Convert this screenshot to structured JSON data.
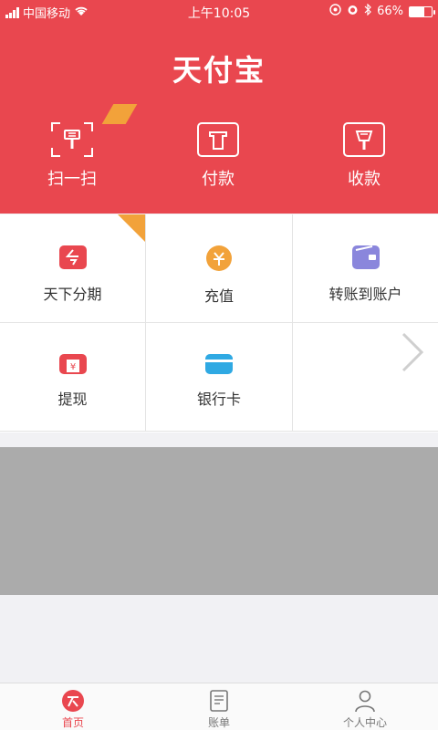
{
  "status_bar": {
    "carrier": "中国移动",
    "time": "上午10:05",
    "battery": "66%",
    "battery_level": 0.66
  },
  "header": {
    "title": "天付宝",
    "actions": [
      {
        "label": "扫一扫",
        "icon": "scan-icon"
      },
      {
        "label": "付款",
        "icon": "pay-icon"
      },
      {
        "label": "收款",
        "icon": "receive-icon"
      }
    ]
  },
  "grid": {
    "items": [
      {
        "label": "天下分期",
        "icon": "installment-icon"
      },
      {
        "label": "充值",
        "icon": "recharge-icon"
      },
      {
        "label": "转账到账户",
        "icon": "wallet-transfer-icon"
      },
      {
        "label": "提现",
        "icon": "withdraw-atm-icon"
      },
      {
        "label": "银行卡",
        "icon": "bank-card-icon"
      },
      {
        "label": "",
        "icon": "chevron-right-icon"
      }
    ]
  },
  "tabbar": {
    "tabs": [
      {
        "label": "首页",
        "icon": "home-logo-icon",
        "active": true
      },
      {
        "label": "账单",
        "icon": "bill-icon",
        "active": false
      },
      {
        "label": "个人中心",
        "icon": "user-icon",
        "active": false
      }
    ]
  },
  "colors": {
    "brand_red": "#e9474f",
    "badge_orange": "#f2a23a",
    "banner_gray": "#ababab"
  }
}
